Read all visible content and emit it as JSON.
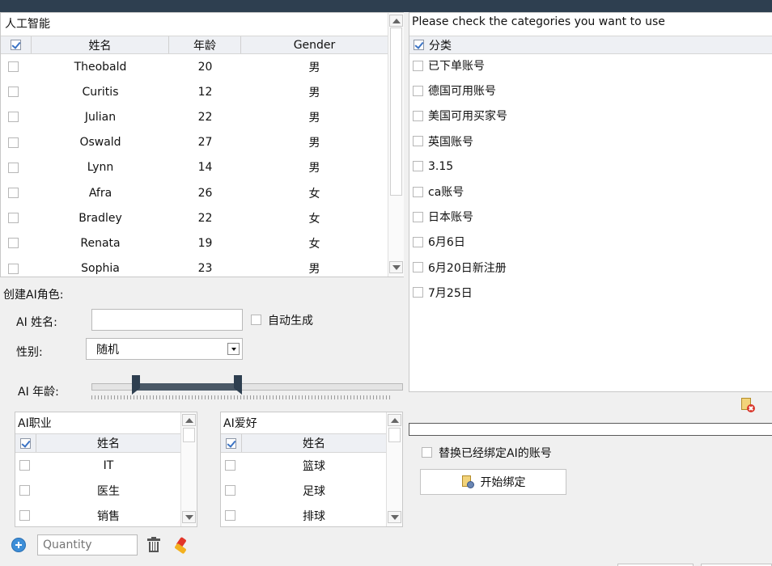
{
  "grid": {
    "title": "人工智能",
    "columns": [
      "姓名",
      "年龄",
      "Gender"
    ],
    "rows": [
      {
        "name": "Theobald",
        "age": "20",
        "gender": "男"
      },
      {
        "name": "Curitis",
        "age": "12",
        "gender": "男"
      },
      {
        "name": "Julian",
        "age": "22",
        "gender": "男"
      },
      {
        "name": "Oswald",
        "age": "27",
        "gender": "男"
      },
      {
        "name": "Lynn",
        "age": "14",
        "gender": "男"
      },
      {
        "name": "Afra",
        "age": "26",
        "gender": "女"
      },
      {
        "name": "Bradley",
        "age": "22",
        "gender": "女"
      },
      {
        "name": "Renata",
        "age": "19",
        "gender": "女"
      },
      {
        "name": "Sophia",
        "age": "23",
        "gender": "男"
      }
    ]
  },
  "create": {
    "title": "创建AI角色:",
    "name_label": "AI 姓名:",
    "name_value": "",
    "auto_label": "自动生成",
    "gender_label": "性别:",
    "gender_value": "随机",
    "age_label": "AI 年龄:"
  },
  "jobs": {
    "title": "AI职业",
    "column": "姓名",
    "items": [
      "IT",
      "医生",
      "销售"
    ]
  },
  "hobbies": {
    "title": "AI爱好",
    "column": "姓名",
    "items": [
      "篮球",
      "足球",
      "排球"
    ]
  },
  "footer": {
    "quantity_placeholder": "Quantity"
  },
  "categories": {
    "prompt": "Please check the categories you want to use",
    "header": "分类",
    "items": [
      "已下单账号",
      "德国可用账号",
      "美国可用买家号",
      "英国账号",
      "3.15",
      "ca账号",
      "日本账号",
      "6月6日",
      "6月20日新注册",
      "7月25日"
    ]
  },
  "bind": {
    "replace_label": "替换已经绑定AI的账号",
    "start_label": "开始绑定"
  },
  "colors": {
    "topbar": "#2e3f50",
    "header_bg": "#eef0f4",
    "slider_fill": "#4a5866",
    "check": "#3b73c4"
  }
}
